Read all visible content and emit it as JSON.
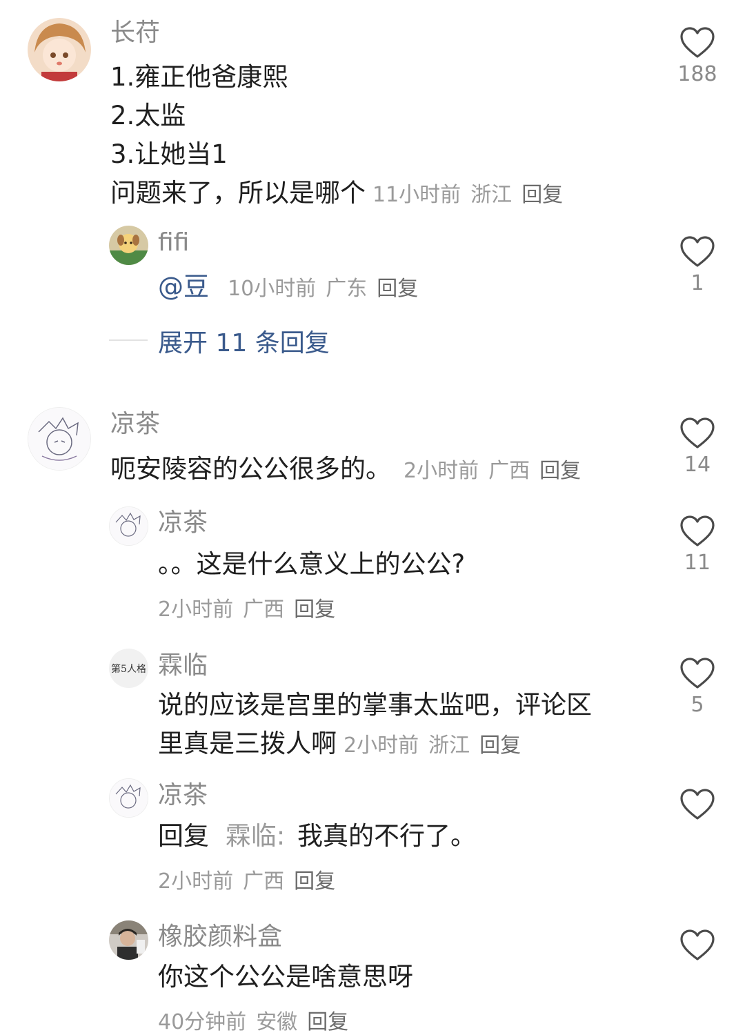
{
  "icons": {
    "like": "heart-outline-icon"
  },
  "colors": {
    "link": "#3a5a8c",
    "meta": "#9a9a9a",
    "name": "#8a8a8a"
  },
  "comments": [
    {
      "user": "长苻",
      "lines": [
        "1.雍正他爸康熙",
        "2.太监",
        "3.让她当1",
        "问题来了，所以是哪个"
      ],
      "time": "11小时前",
      "location": "浙江",
      "reply_label": "回复",
      "likes": "188"
    },
    {
      "user": "fifi",
      "mention": "@豆",
      "time": "10小时前",
      "location": "广东",
      "reply_label": "回复",
      "likes": "1"
    },
    {
      "expand_label": "展开 11 条回复"
    },
    {
      "user": "凉茶",
      "text": "呃安陵容的公公很多的。",
      "time": "2小时前",
      "location": "广西",
      "reply_label": "回复",
      "likes": "14"
    },
    {
      "user": "凉茶",
      "text": "。。这是什么意义上的公公?",
      "time": "2小时前",
      "location": "广西",
      "reply_label": "回复",
      "likes": "11"
    },
    {
      "user": "霖临",
      "avatar_text": "第5人格",
      "lines": [
        "说的应该是宫里的掌事太监吧，评论区",
        "里真是三拨人啊"
      ],
      "time": "2小时前",
      "location": "浙江",
      "reply_label": "回复",
      "likes": "5"
    },
    {
      "user": "凉茶",
      "reply_prefix": "回复",
      "reply_to": "霖临:",
      "text": "我真的不行了。",
      "time": "2小时前",
      "location": "广西",
      "reply_label": "回复",
      "likes": ""
    },
    {
      "user": "橡胶颜料盒",
      "text": "你这个公公是啥意思呀",
      "time": "40分钟前",
      "location": "安徽",
      "reply_label": "回复",
      "likes": ""
    }
  ]
}
